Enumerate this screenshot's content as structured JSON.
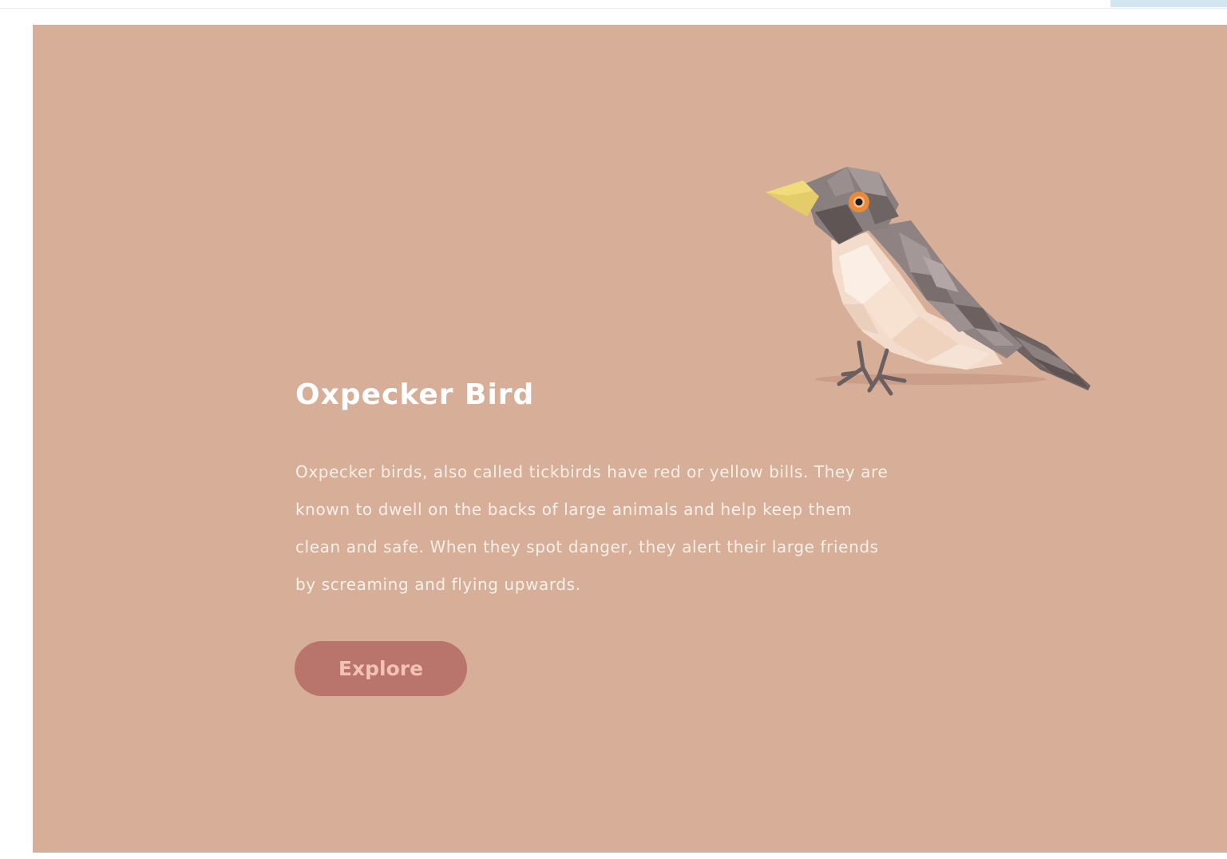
{
  "hero": {
    "title": "Oxpecker Bird",
    "description": "Oxpecker birds, also called tickbirds have red or yellow bills. They are known to dwell on the backs of large animals and help keep them clean and safe. When they spot danger, they alert their large friends by screaming and flying upwards.",
    "cta_label": "Explore",
    "illustration": "oxpecker-bird-illustration"
  },
  "colors": {
    "background": "#d7ae97",
    "button": "#b9746c",
    "button_text": "#f2c2b6",
    "title_text": "#ffffff",
    "body_text": "#fbf1ea",
    "top_tab": "#d3e6ef"
  }
}
